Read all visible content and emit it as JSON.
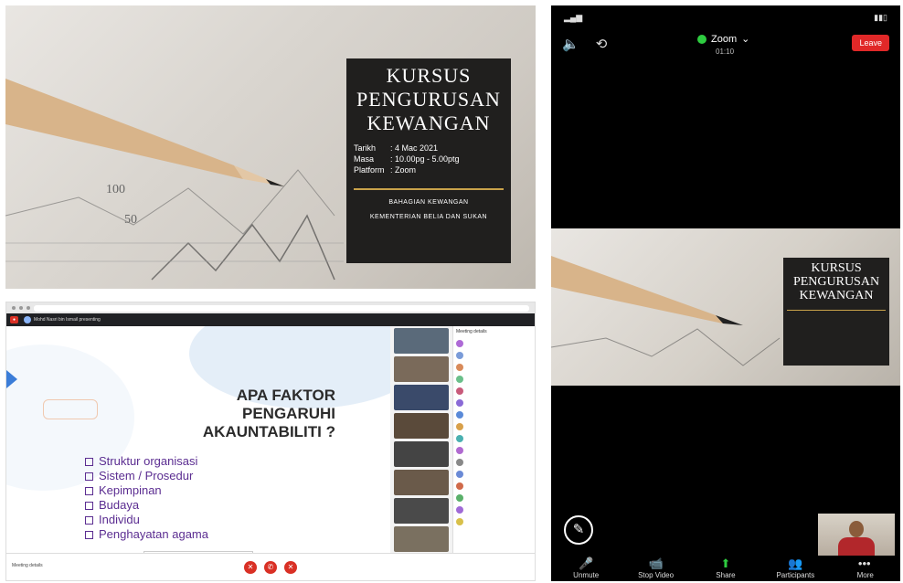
{
  "poster": {
    "title_lines": [
      "KURSUS",
      "PENGURUSAN",
      "KEWANGAN"
    ],
    "rows": [
      {
        "label": "Tarikh",
        "value": ": 4 Mac 2021"
      },
      {
        "label": "Masa",
        "value": ": 10.00pg - 5.00ptg"
      },
      {
        "label": "Platform",
        "value": ": Zoom"
      }
    ],
    "dept_1": "BAHAGIAN KEWANGAN",
    "dept_2": "KEMENTERIAN BELIA DAN SUKAN"
  },
  "meet": {
    "presenter": "Mohd Nasri bin Ismail presenting",
    "slide": {
      "question_lines": [
        "APA FAKTOR",
        "PENGARUHI",
        "AKAUNTABILITI ?"
      ],
      "items": [
        "Struktur organisasi",
        "Sistem / Prosedur",
        "Kepimpinan",
        "Budaya",
        "Individu",
        "Penghayatan agama"
      ]
    },
    "participants_header": "Meeting details",
    "bottom_left": "Meeting details"
  },
  "zoom": {
    "title": "Zoom",
    "timer": "01:10",
    "leave": "Leave",
    "share_title_lines": [
      "KURSUS",
      "PENGURUSAN",
      "KEWANGAN"
    ],
    "toolbar": [
      {
        "icon": "microphone-muted-icon",
        "glyph": "🎤",
        "label": "Unmute"
      },
      {
        "icon": "video-camera-icon",
        "glyph": "📹",
        "label": "Stop Video"
      },
      {
        "icon": "share-screen-icon",
        "glyph": "⬆",
        "label": "Share"
      },
      {
        "icon": "participants-icon",
        "glyph": "👥",
        "label": "Participants"
      },
      {
        "icon": "more-icon",
        "glyph": "•••",
        "label": "More"
      }
    ]
  }
}
